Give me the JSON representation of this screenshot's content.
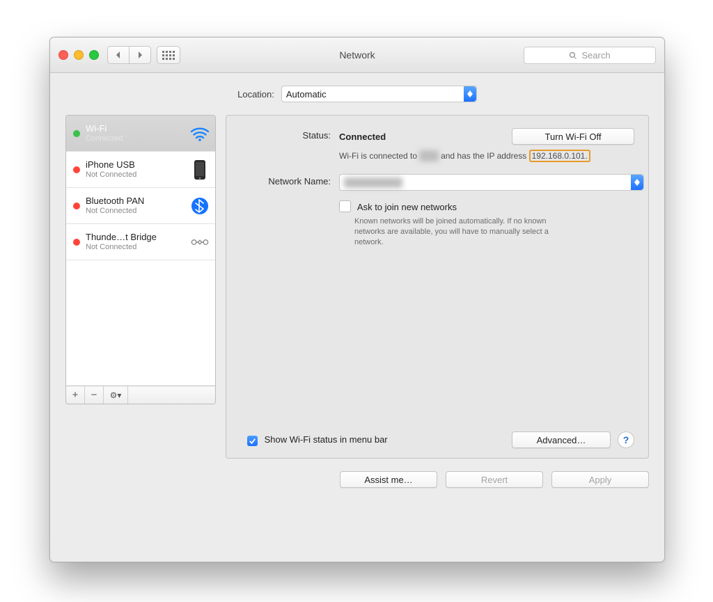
{
  "window": {
    "title": "Network"
  },
  "toolbar": {
    "search_placeholder": "Search"
  },
  "location": {
    "label": "Location:",
    "value": "Automatic"
  },
  "sidebar": {
    "services": [
      {
        "name": "Wi-Fi",
        "sub": "Connected",
        "status": "green"
      },
      {
        "name": "iPhone USB",
        "sub": "Not Connected",
        "status": "red"
      },
      {
        "name": "Bluetooth PAN",
        "sub": "Not Connected",
        "status": "red"
      },
      {
        "name": "Thunde…t Bridge",
        "sub": "Not Connected",
        "status": "red"
      }
    ],
    "add": "+",
    "remove": "−",
    "gear": "✻▾"
  },
  "panel": {
    "status_label": "Status:",
    "status_value": "Connected",
    "wifi_toggle": "Turn Wi-Fi Off",
    "info_prefix": "Wi-Fi is connected to ",
    "info_suffix": " and has the IP address ",
    "ip": "192.168.0.101.",
    "network_name_label": "Network Name:",
    "network_name_value": "",
    "ask_label": "Ask to join new networks",
    "known_text": "Known networks will be joined automatically. If no known networks are available, you will have to manually select a network.",
    "show_status_label": "Show Wi-Fi status in menu bar",
    "advanced": "Advanced…",
    "help": "?"
  },
  "bottom": {
    "assist": "Assist me…",
    "revert": "Revert",
    "apply": "Apply"
  }
}
